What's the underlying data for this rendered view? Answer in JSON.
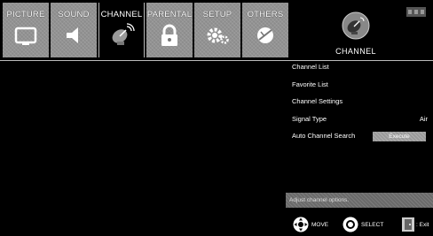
{
  "tabs": [
    {
      "label": "PICTURE",
      "icon": "tv-icon",
      "selected": false
    },
    {
      "label": "SOUND",
      "icon": "speaker-icon",
      "selected": false
    },
    {
      "label": "CHANNEL",
      "icon": "satellite-dish-icon",
      "selected": true
    },
    {
      "label": "PARENTAL",
      "icon": "padlock-icon",
      "selected": false
    },
    {
      "label": "SETUP",
      "icon": "gears-icon",
      "selected": false
    },
    {
      "label": "OTHERS",
      "icon": "globe-icon",
      "selected": false
    }
  ],
  "selected_panel": {
    "label": "CHANNEL",
    "icon": "satellite-dish-icon"
  },
  "brand": {
    "logo": "brand-logo-icon"
  },
  "menu": {
    "items": [
      {
        "label": "Channel List"
      },
      {
        "label": "Favorite List"
      },
      {
        "label": "Channel Settings"
      },
      {
        "label": "Signal Type",
        "value": "Air"
      },
      {
        "label": "Auto Channel Search",
        "button": "Execute"
      }
    ]
  },
  "help_text": "Adjust channel options.",
  "hints": {
    "move": "MOVE",
    "select": "SELECT",
    "exit": ": Exit"
  },
  "colors": {
    "background": "#000000",
    "tab": "#8c8c8c",
    "button": "#9a9a9a"
  }
}
